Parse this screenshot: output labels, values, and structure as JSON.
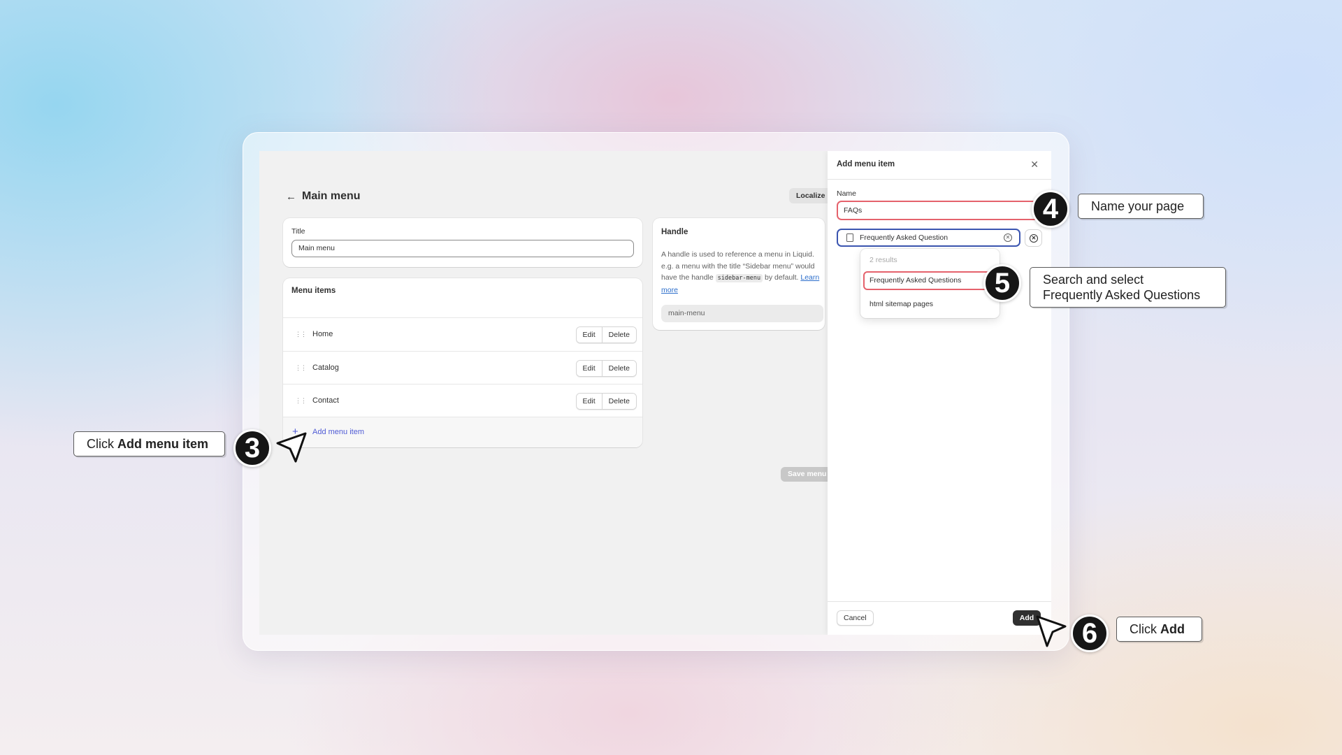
{
  "app": {
    "page_title": "Main menu",
    "back_icon": "arrow-left-icon",
    "localize_label": "Localize",
    "save_label": "Save menu"
  },
  "title_card": {
    "label": "Title",
    "value": "Main menu"
  },
  "menu_items": {
    "heading": "Menu items",
    "items": [
      {
        "label": "Home",
        "edit": "Edit",
        "delete": "Delete"
      },
      {
        "label": "Catalog",
        "edit": "Edit",
        "delete": "Delete"
      },
      {
        "label": "Contact",
        "edit": "Edit",
        "delete": "Delete"
      }
    ],
    "add_label": "Add menu item",
    "add_icon": "plus-icon"
  },
  "handle_card": {
    "heading": "Handle",
    "desc_1": "A handle is used to reference a menu in Liquid. e.g. a menu with the title “Sidebar menu” would have the handle",
    "code": "sidebar-menu",
    "desc_2": "by default.",
    "link": "Learn more",
    "value": "main-menu"
  },
  "panel": {
    "title": "Add menu item",
    "close_icon": "close-icon",
    "name_label": "Name",
    "name_value": "FAQs",
    "link_value": "Frequently Asked Question",
    "results_count": "2 results",
    "options": [
      "Frequently Asked Questions",
      "html sitemap pages"
    ],
    "cancel_label": "Cancel",
    "add_label": "Add"
  },
  "annotations": {
    "step3": {
      "number": "3",
      "prefix": "Click",
      "bold": "Add menu item"
    },
    "step4": {
      "number": "4",
      "text": "Name your page"
    },
    "step5": {
      "number": "5",
      "line1": "Search and select",
      "line2": "Frequently Asked Questions"
    },
    "step6": {
      "number": "6",
      "prefix": "Click",
      "bold": "Add"
    }
  },
  "colors": {
    "highlight": "#e5626c",
    "focus": "#3b55b0",
    "link": "#4f5bd5",
    "primary_button": "#303030"
  }
}
